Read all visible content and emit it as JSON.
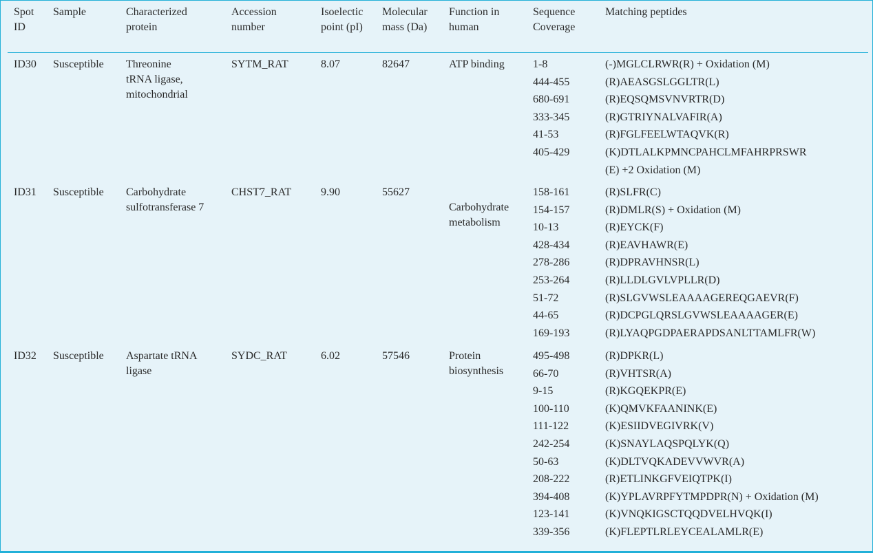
{
  "table": {
    "headers": [
      [
        "Spot",
        "ID"
      ],
      [
        "Sample"
      ],
      [
        "Characterized",
        "protein"
      ],
      [
        "Accession",
        "number"
      ],
      [
        "Isoelectic",
        "point (pI)"
      ],
      [
        "Molecular",
        "mass (Da)"
      ],
      [
        "Function in",
        "human"
      ],
      [
        "Sequence",
        "Coverage"
      ],
      [
        "Matching peptides"
      ]
    ],
    "rows": [
      {
        "spot_id": "ID30",
        "sample": "Susceptible",
        "protein": [
          "Threonine",
          "tRNA ligase,",
          "mitochondrial"
        ],
        "accession": "SYTM_RAT",
        "pi": "8.07",
        "mass": "82647",
        "function": [
          "ATP binding"
        ],
        "peptides": [
          {
            "coverage": "1-8",
            "sequence": "(-)MGLCLRWR(R) + Oxidation (M)"
          },
          {
            "coverage": "444-455",
            "sequence": "(R)AEASGSLGGLTR(L)"
          },
          {
            "coverage": "680-691",
            "sequence": "(R)EQSQMSVNVRTR(D)"
          },
          {
            "coverage": "333-345",
            "sequence": "(R)GTRIYNALVAFIR(A)"
          },
          {
            "coverage": "41-53",
            "sequence": "(R)FGLFEELWTAQVK(R)"
          },
          {
            "coverage": "405-429",
            "sequence": "(K)DTLALKPMNCPAHCLMFAHRPRSWR"
          },
          {
            "coverage": "",
            "sequence": "(E) +2 Oxidation (M)"
          }
        ]
      },
      {
        "spot_id": "ID31",
        "sample": "Susceptible",
        "protein": [
          "Carbohydrate",
          "sulfotransferase 7"
        ],
        "accession": "CHST7_RAT",
        "pi": "9.90",
        "mass": "55627",
        "function": [
          "Carbohydrate",
          "metabolism"
        ],
        "peptides": [
          {
            "coverage": "158-161",
            "sequence": "(R)SLFR(C)"
          },
          {
            "coverage": "154-157",
            "sequence": "(R)DMLR(S) + Oxidation (M)"
          },
          {
            "coverage": "10-13",
            "sequence": "(R)EYCK(F)"
          },
          {
            "coverage": "428-434",
            "sequence": "(R)EAVHAWR(E)"
          },
          {
            "coverage": "278-286",
            "sequence": "(R)DPRAVHNSR(L)"
          },
          {
            "coverage": "253-264",
            "sequence": "(R)LLDLGVLVPLLR(D)"
          },
          {
            "coverage": "51-72",
            "sequence": "(R)SLGVWSLEAAAAGEREQGAEVR(F)"
          },
          {
            "coverage": "44-65",
            "sequence": "(R)DCPGLQRSLGVWSLEAAAAGER(E)"
          },
          {
            "coverage": "169-193",
            "sequence": "(R)LYAQPGDPAERAPDSANLTTAMLFR(W)"
          }
        ]
      },
      {
        "spot_id": "ID32",
        "sample": "Susceptible",
        "protein": [
          "Aspartate tRNA",
          "ligase"
        ],
        "accession": "SYDC_RAT",
        "pi": "6.02",
        "mass": "57546",
        "function": [
          "Protein",
          "biosynthesis"
        ],
        "peptides": [
          {
            "coverage": "495-498",
            "sequence": "(R)DPKR(L)"
          },
          {
            "coverage": "66-70",
            "sequence": "(R)VHTSR(A)"
          },
          {
            "coverage": "9-15",
            "sequence": "(R)KGQEKPR(E)"
          },
          {
            "coverage": "100-110",
            "sequence": "(K)QMVKFAANINK(E)"
          },
          {
            "coverage": "111-122",
            "sequence": "(K)ESIIDVEGIVRK(V)"
          },
          {
            "coverage": "242-254",
            "sequence": "(K)SNAYLAQSPQLYK(Q)"
          },
          {
            "coverage": "50-63",
            "sequence": "(K)DLTVQKADEVVWVR(A)"
          },
          {
            "coverage": "208-222",
            "sequence": "(R)ETLINKGFVEIQTPK(I)"
          },
          {
            "coverage": "394-408",
            "sequence": "(K)YPLAVRPFYTMPDPR(N) + Oxidation (M)"
          },
          {
            "coverage": "123-141",
            "sequence": "(K)VNQKIGSCTQQDVELHVQK(I)"
          },
          {
            "coverage": "339-356",
            "sequence": "(K)FLEPTLRLEYCEALAMLR(E)"
          }
        ]
      }
    ]
  }
}
